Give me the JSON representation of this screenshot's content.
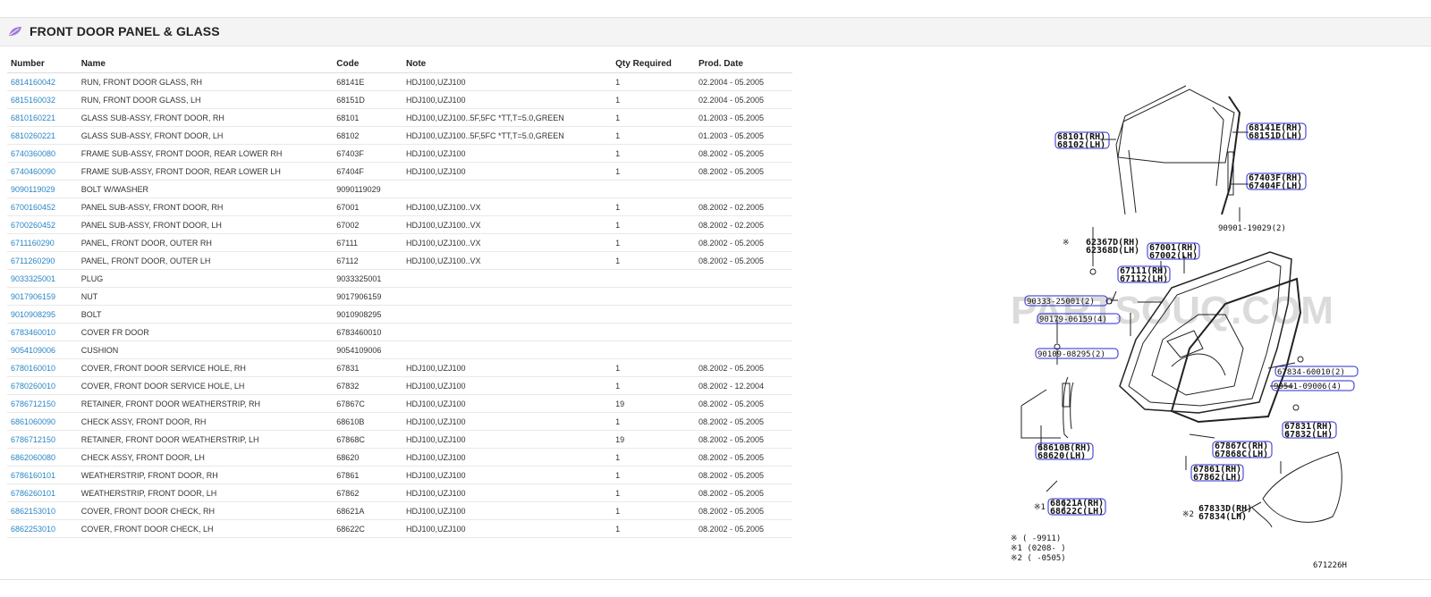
{
  "section": {
    "title": "FRONT DOOR PANEL & GLASS",
    "icon": "leaf-icon",
    "icon_color": "#9b6fd6"
  },
  "table": {
    "headers": [
      "Number",
      "Name",
      "Code",
      "Note",
      "Qty Required",
      "Prod. Date"
    ],
    "rows": [
      [
        "6814160042",
        "RUN, FRONT DOOR GLASS, RH",
        "68141E",
        "HDJ100,UZJ100",
        "1",
        "02.2004 - 05.2005"
      ],
      [
        "6815160032",
        "RUN, FRONT DOOR GLASS, LH",
        "68151D",
        "HDJ100,UZJ100",
        "1",
        "02.2004 - 05.2005"
      ],
      [
        "6810160221",
        "GLASS SUB-ASSY, FRONT DOOR, RH",
        "68101",
        "HDJ100,UZJ100..5F,5FC *TT,T=5.0,GREEN",
        "1",
        "01.2003 - 05.2005"
      ],
      [
        "6810260221",
        "GLASS SUB-ASSY, FRONT DOOR, LH",
        "68102",
        "HDJ100,UZJ100..5F,5FC *TT,T=5.0,GREEN",
        "1",
        "01.2003 - 05.2005"
      ],
      [
        "6740360080",
        "FRAME SUB-ASSY, FRONT DOOR, REAR LOWER RH",
        "67403F",
        "HDJ100,UZJ100",
        "1",
        "08.2002 - 05.2005"
      ],
      [
        "6740460090",
        "FRAME SUB-ASSY, FRONT DOOR, REAR LOWER LH",
        "67404F",
        "HDJ100,UZJ100",
        "1",
        "08.2002 - 05.2005"
      ],
      [
        "9090119029",
        "BOLT W/WASHER",
        "9090119029",
        "",
        "",
        ""
      ],
      [
        "6700160452",
        "PANEL SUB-ASSY, FRONT DOOR, RH",
        "67001",
        "HDJ100,UZJ100..VX",
        "1",
        "08.2002 - 02.2005"
      ],
      [
        "6700260452",
        "PANEL SUB-ASSY, FRONT DOOR, LH",
        "67002",
        "HDJ100,UZJ100..VX",
        "1",
        "08.2002 - 02.2005"
      ],
      [
        "6711160290",
        "PANEL, FRONT DOOR, OUTER RH",
        "67111",
        "HDJ100,UZJ100..VX",
        "1",
        "08.2002 - 05.2005"
      ],
      [
        "6711260290",
        "PANEL, FRONT DOOR, OUTER LH",
        "67112",
        "HDJ100,UZJ100..VX",
        "1",
        "08.2002 - 05.2005"
      ],
      [
        "9033325001",
        "PLUG",
        "9033325001",
        "",
        "",
        ""
      ],
      [
        "9017906159",
        "NUT",
        "9017906159",
        "",
        "",
        ""
      ],
      [
        "9010908295",
        "BOLT",
        "9010908295",
        "",
        "",
        ""
      ],
      [
        "6783460010",
        "COVER FR DOOR",
        "6783460010",
        "",
        "",
        ""
      ],
      [
        "9054109006",
        "CUSHION",
        "9054109006",
        "",
        "",
        ""
      ],
      [
        "6780160010",
        "COVER, FRONT DOOR SERVICE HOLE, RH",
        "67831",
        "HDJ100,UZJ100",
        "1",
        "08.2002 - 05.2005"
      ],
      [
        "6780260010",
        "COVER, FRONT DOOR SERVICE HOLE, LH",
        "67832",
        "HDJ100,UZJ100",
        "1",
        "08.2002 - 12.2004"
      ],
      [
        "6786712150",
        "RETAINER, FRONT DOOR WEATHERSTRIP, RH",
        "67867C",
        "HDJ100,UZJ100",
        "19",
        "08.2002 - 05.2005"
      ],
      [
        "6861060090",
        "CHECK ASSY, FRONT DOOR, RH",
        "68610B",
        "HDJ100,UZJ100",
        "1",
        "08.2002 - 05.2005"
      ],
      [
        "6786712150",
        "RETAINER, FRONT DOOR WEATHERSTRIP, LH",
        "67868C",
        "HDJ100,UZJ100",
        "19",
        "08.2002 - 05.2005"
      ],
      [
        "6862060080",
        "CHECK ASSY, FRONT DOOR, LH",
        "68620",
        "HDJ100,UZJ100",
        "1",
        "08.2002 - 05.2005"
      ],
      [
        "6786160101",
        "WEATHERSTRIP, FRONT DOOR, RH",
        "67861",
        "HDJ100,UZJ100",
        "1",
        "08.2002 - 05.2005"
      ],
      [
        "6786260101",
        "WEATHERSTRIP, FRONT DOOR, LH",
        "67862",
        "HDJ100,UZJ100",
        "1",
        "08.2002 - 05.2005"
      ],
      [
        "6862153010",
        "COVER, FRONT DOOR CHECK, RH",
        "68621A",
        "HDJ100,UZJ100",
        "1",
        "08.2002 - 05.2005"
      ],
      [
        "6862253010",
        "COVER, FRONT DOOR CHECK, LH",
        "68622C",
        "HDJ100,UZJ100",
        "1",
        "08.2002 - 05.2005"
      ]
    ]
  },
  "diagram": {
    "watermark": "PARTSOUQ.COM",
    "drawing_id": "671226H",
    "labels": [
      [
        "68101(RH)",
        "68102(LH)"
      ],
      [
        "68141E(RH)",
        "68151D(LH)"
      ],
      [
        "67403F(RH)",
        "67404F(LH)"
      ],
      [
        "90901-19029(2)"
      ],
      [
        "62367D(RH)",
        "62368D(LH)"
      ],
      [
        "67001(RH)",
        "67002(LH)"
      ],
      [
        "67111(RH)",
        "67112(LH)"
      ],
      [
        "90333-25001(2)"
      ],
      [
        "90179-06159(4)"
      ],
      [
        "90109-08295(2)"
      ],
      [
        "67834-60010(2)"
      ],
      [
        "90541-09006(4)"
      ],
      [
        "67831(RH)",
        "67832(LH)"
      ],
      [
        "68610B(RH)",
        "68620(LH)"
      ],
      [
        "67867C(RH)",
        "67868C(LH)"
      ],
      [
        "67861(RH)",
        "67862(LH)"
      ],
      [
        "68621A(RH)",
        "68622C(LH)"
      ],
      [
        "67833D(RH)",
        "67834(LH)"
      ]
    ],
    "marks": {
      "star": "※",
      "star1": "※1",
      "star2": "※2"
    },
    "notes": [
      "※ (    -9911)",
      "※1 (0208-    )",
      "※2 (    -0505)"
    ]
  }
}
